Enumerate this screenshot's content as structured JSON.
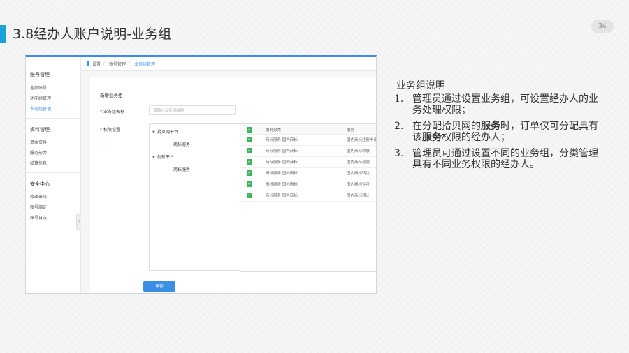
{
  "slide": {
    "title": "3.8经办人账户说明-业务组",
    "page_number": "34"
  },
  "app": {
    "sidebar": {
      "groups": [
        {
          "label": "账号管理",
          "items": [
            "全部账号",
            "功能组管理",
            "业务组管理"
          ]
        },
        {
          "label": "资料管理",
          "items": [
            "基本资料",
            "服务能力",
            "结算信息"
          ]
        },
        {
          "label": "安全中心",
          "items": [
            "修改密码",
            "账号绑定",
            "账号日志"
          ]
        }
      ],
      "active_item": "业务组管理"
    },
    "breadcrumb": [
      "设置",
      "账号管理",
      "业务组管理"
    ],
    "form": {
      "section_title": "新增业务组",
      "name_label": "业务组名称",
      "name_placeholder": "请输入业务组名称",
      "perm_label": "权限设置",
      "tree": [
        {
          "label": "拾贝网平台",
          "children": [
            "商标服务"
          ]
        },
        {
          "label": "创新平台",
          "children": [
            "商标服务"
          ]
        }
      ],
      "table_headers": [
        "服务分类",
        "服务"
      ],
      "table_rows": [
        {
          "category": "商标服务  国内商标",
          "service": "国内商标注册申请"
        },
        {
          "category": "商标服务  国内商标",
          "service": "国内商标续展"
        },
        {
          "category": "商标服务  国内商标",
          "service": "国内商标变更"
        },
        {
          "category": "商标服务  国内商标",
          "service": "国内商标转让"
        },
        {
          "category": "商标服务  国内商标",
          "service": "国内商标许可"
        },
        {
          "category": "商标服务  国内商标",
          "service": "国内商标转让"
        }
      ],
      "save_label": "保存"
    }
  },
  "description": {
    "title": "业务组说明",
    "items": [
      {
        "num": "1.",
        "parts": [
          {
            "t": "管理员通过设置业务组，可设置经办人的业务处理权限；"
          }
        ]
      },
      {
        "num": "2.",
        "parts": [
          {
            "t": "在分配拾贝网的"
          },
          {
            "t": "服务",
            "bold": true
          },
          {
            "t": "时，订单仅可分配具有该"
          },
          {
            "t": "服务",
            "bold": true
          },
          {
            "t": "权限的经办人；"
          }
        ]
      },
      {
        "num": "3.",
        "parts": [
          {
            "t": "管理员可通过设置不同的业务组，分类管理具有不同业务权限的经办人。"
          }
        ]
      }
    ]
  }
}
